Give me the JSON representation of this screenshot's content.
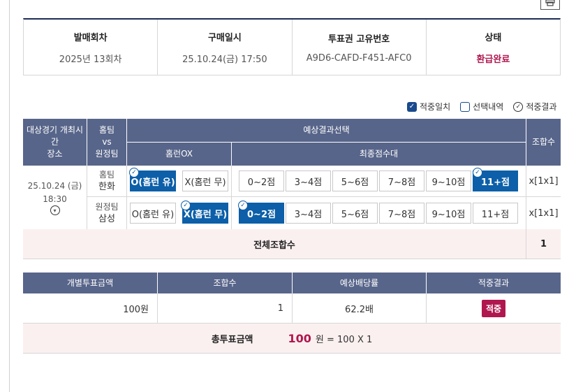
{
  "info": {
    "columns": [
      {
        "label": "발매회차",
        "value": "2025년 13회차"
      },
      {
        "label": "구매일시",
        "value": "25.10.24(금) 17:50"
      },
      {
        "label": "투표권 고유번호",
        "value": "A9D6-CAFD-F451-AFC0"
      },
      {
        "label": "상태",
        "value": "환급완료"
      }
    ]
  },
  "legend": {
    "hit_match": "적중일치",
    "selection": "선택내역",
    "hit_result": "적중결과"
  },
  "table": {
    "headers": {
      "game_time_place": "대상경기 개최시간\n장소",
      "home_vs_away": "홈팀\nvs\n원정팀",
      "prediction": "예상결과선택",
      "combos": "조합수",
      "homerun_ox": "홈런OX",
      "final_score": "최종점수대"
    },
    "game": {
      "date": "25.10.24 (금)",
      "time": "18:30"
    },
    "rows": [
      {
        "team_role": "홈팀",
        "team_name": "한화",
        "ox": [
          "O(홈런 유)",
          "X(홈런 무)"
        ],
        "scores": [
          "0~2점",
          "3~4점",
          "5~6점",
          "7~8점",
          "9~10점",
          "11+점"
        ],
        "combo": "x[1x1]"
      },
      {
        "team_role": "원정팀",
        "team_name": "삼성",
        "ox": [
          "O(홈런 유)",
          "X(홈런 무)"
        ],
        "scores": [
          "0~2점",
          "3~4점",
          "5~6점",
          "7~8점",
          "9~10점",
          "11+점"
        ],
        "combo": "x[1x1]"
      }
    ],
    "total_label": "전체조합수",
    "total_value": "1"
  },
  "summary": {
    "headers": [
      "개별투표금액",
      "조합수",
      "예상배당률",
      "적중결과"
    ],
    "values": [
      "100원",
      "1",
      "62.2배",
      "적중"
    ],
    "total_label": "총투표금액",
    "total_amount": "100",
    "total_formula": "원 = 100 X 1"
  },
  "colors": {
    "header_bg": "#58658a",
    "selected_bg": "#0c5fa8",
    "status_red": "#b0174f",
    "total_row_bg": "#fbf0f0"
  }
}
